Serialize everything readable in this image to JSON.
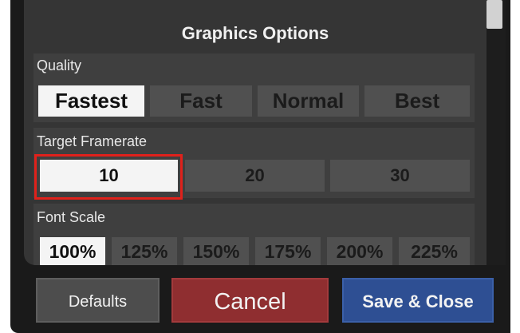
{
  "dialog": {
    "title": "Graphics Options"
  },
  "quality": {
    "label": "Quality",
    "options": [
      "Fastest",
      "Fast",
      "Normal",
      "Best"
    ],
    "selected": "Fastest"
  },
  "framerate": {
    "label": "Target Framerate",
    "options": [
      "10",
      "20",
      "30"
    ],
    "selected": "10"
  },
  "font_scale": {
    "label": "Font Scale",
    "options": [
      "100%",
      "125%",
      "150%",
      "175%",
      "200%",
      "225%"
    ],
    "selected": "100%"
  },
  "buttons": {
    "defaults": "Defaults",
    "cancel": "Cancel",
    "save_close": "Save & Close"
  },
  "colors": {
    "cancel_bg": "#8f2e30",
    "save_bg": "#2e4f93",
    "defaults_bg": "#4d4d4d",
    "selection_highlight": "#e0211b"
  }
}
